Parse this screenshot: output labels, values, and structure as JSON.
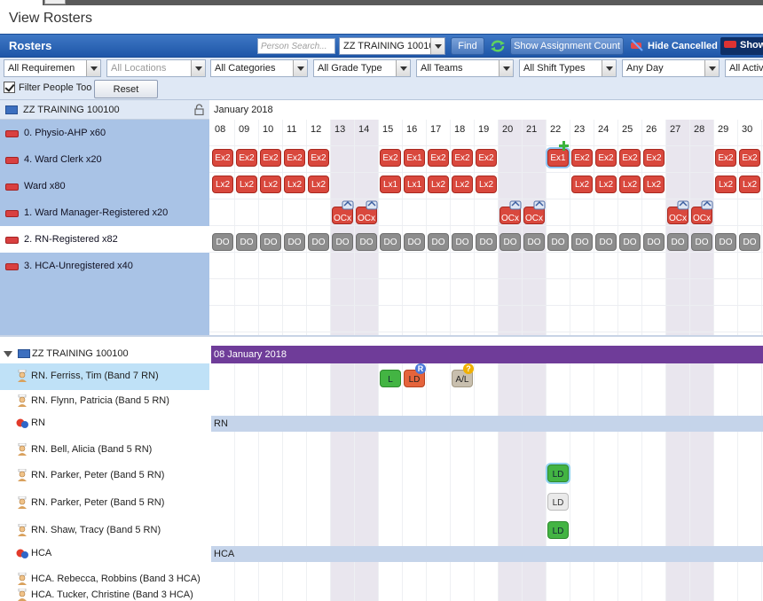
{
  "page_title": "View Rosters",
  "toolbar": {
    "title": "Rosters",
    "search_placeholder": "Person Search...",
    "unit_value": "ZZ TRAINING 10010",
    "find_label": "Find",
    "show_assignment_label": "Show Assignment Count",
    "hide_cancelled_label": "Hide Cancelled",
    "show_label": "Show"
  },
  "filters": {
    "requirements": "All Requiremen",
    "locations": "All Locations",
    "categories": "All Categories",
    "grade_type": "All Grade Type",
    "teams": "All Teams",
    "shift_types": "All Shift Types",
    "day": "Any Day",
    "activity": "All Activ"
  },
  "filter_people_label": "Filter People Too",
  "filter_people_checked": true,
  "reset_label": "Reset",
  "roster_unit": "ZZ TRAINING 100100",
  "month_label": "January 2018",
  "days": [
    "08",
    "09",
    "10",
    "11",
    "12",
    "13",
    "14",
    "15",
    "16",
    "17",
    "18",
    "19",
    "20",
    "21",
    "22",
    "23",
    "24",
    "25",
    "26",
    "27",
    "28",
    "29",
    "30"
  ],
  "weekend_days": [
    "13",
    "14",
    "20",
    "21",
    "27",
    "28"
  ],
  "requirements": [
    {
      "label": "0. Physio-AHP x60"
    },
    {
      "label": "4. Ward Clerk x20"
    },
    {
      "label": "Ward  x80"
    },
    {
      "label": "1. Ward Manager-Registered x20"
    },
    {
      "label": "2. RN-Registered x82"
    },
    {
      "label": "3. HCA-Unregistered x40"
    }
  ],
  "req_shifts": {
    "ward_clerk": [
      "Ex2",
      "Ex2",
      "Ex2",
      "Ex2",
      "Ex2",
      "",
      "",
      "Ex2",
      "Ex1",
      "Ex2",
      "Ex2",
      "Ex2",
      "",
      "",
      "Ex1",
      "Ex2",
      "Ex2",
      "Ex2",
      "Ex2",
      "",
      "",
      "Ex2",
      "Ex2"
    ],
    "ward": [
      "Lx2",
      "Lx2",
      "Lx2",
      "Lx2",
      "Lx2",
      "",
      "",
      "Lx1",
      "Lx1",
      "Lx2",
      "Lx2",
      "Lx2",
      "",
      "",
      "",
      "Lx2",
      "Lx2",
      "Lx2",
      "Lx2",
      "",
      "",
      "Lx2",
      "Lx2"
    ],
    "manager": [
      "",
      "",
      "",
      "",
      "",
      "OCx",
      "OCx",
      "",
      "",
      "",
      "",
      "",
      "OCx",
      "OCx",
      "",
      "",
      "",
      "",
      "",
      "OCx",
      "OCx",
      "",
      ""
    ],
    "rn": [
      "DO",
      "DO",
      "DO",
      "DO",
      "DO",
      "DO",
      "DO",
      "DO",
      "DO",
      "DO",
      "DO",
      "DO",
      "DO",
      "DO",
      "DO",
      "DO",
      "DO",
      "DO",
      "DO",
      "DO",
      "DO",
      "DO",
      "DO"
    ]
  },
  "people_section": {
    "unit": "ZZ TRAINING 100100",
    "week_label": "08 January 2018",
    "rows": [
      {
        "type": "person",
        "label": "RN. Ferriss, Tim (Band 7 RN)"
      },
      {
        "type": "person",
        "label": "RN. Flynn, Patricia (Band 5 RN)"
      },
      {
        "type": "role",
        "label": "RN",
        "band": "RN"
      },
      {
        "type": "person",
        "label": "RN. Bell, Alicia (Band 5 RN)"
      },
      {
        "type": "person",
        "label": "RN. Parker, Peter (Band 5 RN)"
      },
      {
        "type": "person",
        "label": "RN. Parker, Peter (Band 5 RN)"
      },
      {
        "type": "person",
        "label": "RN. Shaw, Tracy (Band 5 RN)"
      },
      {
        "type": "role",
        "label": "HCA",
        "band": "HCA"
      },
      {
        "type": "person",
        "label": "HCA. Rebecca, Robbins (Band 3 HCA)"
      },
      {
        "type": "person",
        "label": "HCA. Tucker, Christine (Band 3 HCA)"
      }
    ],
    "shifts": {
      "ferriss_l": "L",
      "ferriss_ld": "LD",
      "ferriss_ld_badge": "R",
      "ferriss_al": "A/L",
      "ferriss_al_badge": "?",
      "parker1_ld": "LD",
      "parker2_ld": "LD",
      "shaw_ld": "LD"
    }
  },
  "colors": {
    "header_blue": "#1e56a8",
    "requirement_panel": "#a9c3e6",
    "shift_red": "#d9483d",
    "shift_gray": "#8d8d8d",
    "week_band_purple": "#6f3c99",
    "shift_green": "#43b443"
  }
}
